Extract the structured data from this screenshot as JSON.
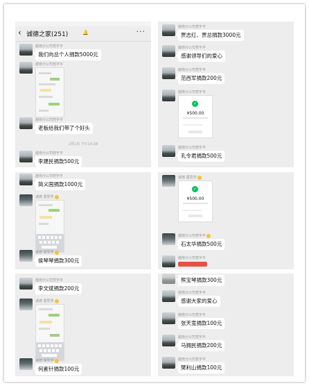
{
  "chat": {
    "title": "诚德之家(251)",
    "back_glyph": "‹",
    "more_glyph": "···",
    "mute_glyph": "🔔"
  },
  "panel1": {
    "messages": [
      {
        "sender": "越南分公司党宇平",
        "text": "我们向总个人捐款5000元"
      },
      {
        "sender": "越南分公司党宇平",
        "text": "老板给我们带了个好头"
      },
      {
        "sender": "越南分公司党宇平",
        "text": "李建民捐款500元"
      }
    ],
    "timestamp": "2月1日 下午14:38"
  },
  "panel2": {
    "messages": [
      {
        "sender": "越南分公司党宇平",
        "text": "贾志红、贾总捐款3000元"
      },
      {
        "sender": "越南分公司党宇平",
        "text": "感谢领导们的爱心"
      },
      {
        "sender": "越南分公司党宇平",
        "text": "范西军捐款200元"
      },
      {
        "sender": "越南分公司党宇平",
        "text": "孔令君捐款500元"
      }
    ],
    "payment_amount": "¥500.00"
  },
  "panel3": {
    "messages": [
      {
        "sender": "越南分公司党宇平",
        "text": "简义国捐款1000元"
      },
      {
        "sender": "诚德 霍赞芳",
        "text": ""
      },
      {
        "sender": "诚德 霍赞芳",
        "text": "侯琴琴捐款300元"
      }
    ]
  },
  "panel4": {
    "messages": [
      {
        "sender": "诚德 霍赞芳",
        "text": ""
      },
      {
        "sender": "越南分公司党宇平",
        "text": "石太华捐款500元"
      },
      {
        "sender": "越南分公司党宇平",
        "text": ""
      }
    ],
    "payment_amount": "¥500.00"
  },
  "panel5": {
    "messages": [
      {
        "sender": "越南分公司党宇平",
        "text": "李文斌捐款200元"
      },
      {
        "sender": "诚德 霍赞芳",
        "text": ""
      },
      {
        "sender": "诚德 霍赞芳",
        "text": "何素针捐款100元"
      }
    ]
  },
  "panel6": {
    "messages": [
      {
        "sender": "",
        "text": "熊宝琴捐款300元"
      },
      {
        "sender": "越南分公司党宇平",
        "text": "感谢大家的爱心"
      },
      {
        "sender": "越南分公司党宇平",
        "text": "张天宽捐款100元"
      },
      {
        "sender": "越南分公司党宇平",
        "text": "马拥民捐款200元"
      },
      {
        "sender": "越南分公司党宇平",
        "text": "樊利山捐款100元"
      }
    ]
  },
  "colors": {
    "chat_background": "#ededed",
    "bubble": "#ffffff",
    "wechat_green": "#07c160",
    "red_packet": "#e5533e"
  }
}
